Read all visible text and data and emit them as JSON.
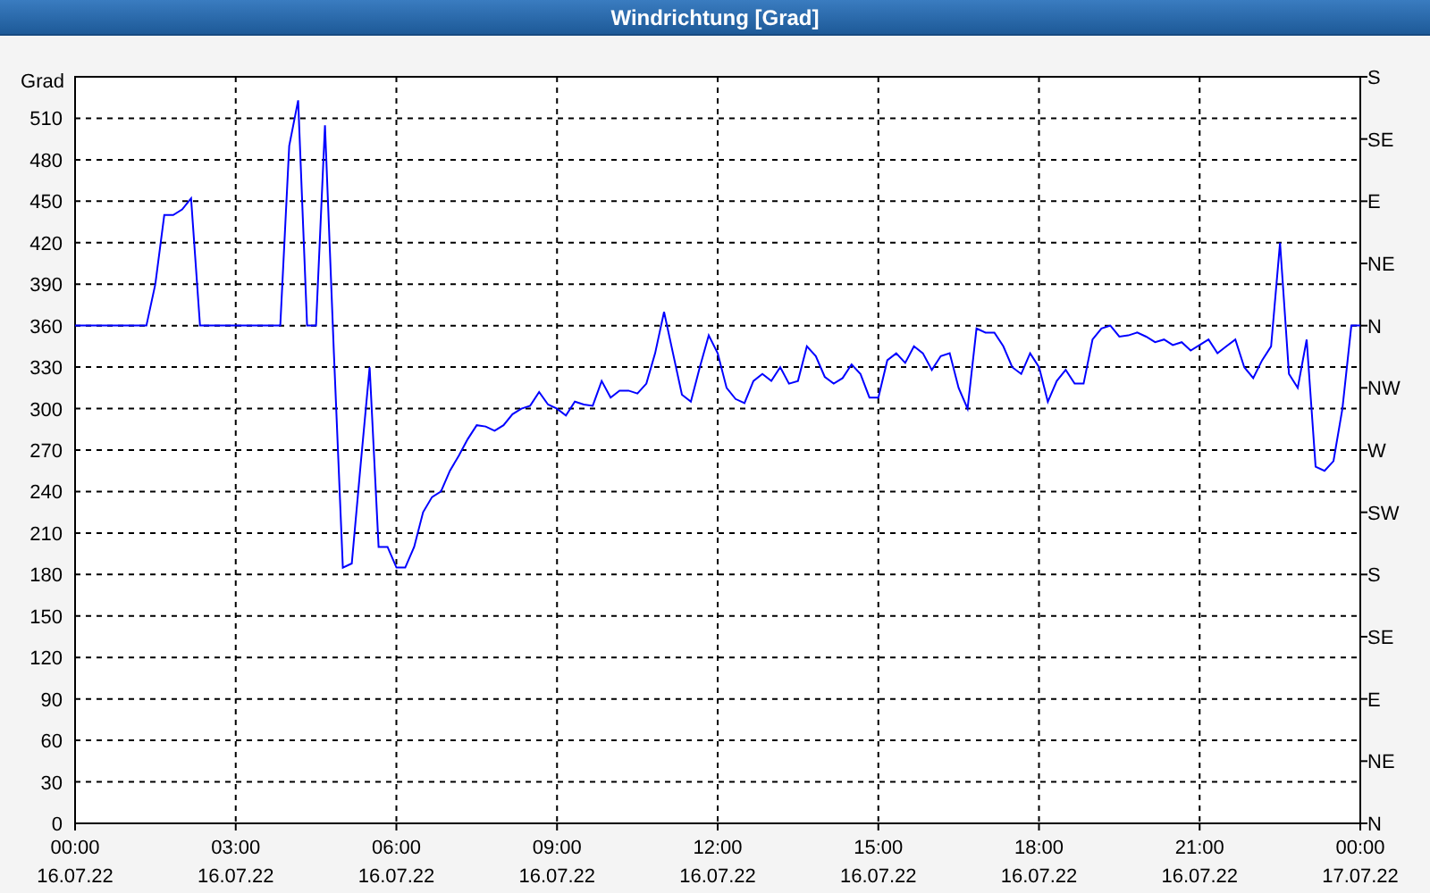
{
  "window": {
    "title": "Windrichtung [Grad]"
  },
  "chart": {
    "right_axis_labels": [
      "S",
      "SE",
      "E",
      "NE",
      "N",
      "NW",
      "W",
      "SW",
      "S",
      "SE",
      "E",
      "NE",
      "N"
    ],
    "chart_data": {
      "type": "line",
      "ylabel": "Grad",
      "grid": true,
      "ylim": [
        0,
        540
      ],
      "yticks": [
        0,
        30,
        60,
        90,
        120,
        150,
        180,
        210,
        240,
        270,
        300,
        330,
        360,
        390,
        420,
        450,
        480,
        510
      ],
      "categories": [
        "00:00\n16.07.22",
        null,
        null,
        null,
        null,
        null,
        null,
        null,
        null,
        null,
        null,
        null,
        null,
        null,
        null,
        null,
        null,
        null,
        "03:00\n16.07.22",
        null,
        null,
        null,
        null,
        null,
        null,
        null,
        null,
        null,
        null,
        null,
        null,
        null,
        null,
        null,
        null,
        null,
        "06:00\n16.07.22",
        null,
        null,
        null,
        null,
        null,
        null,
        null,
        null,
        null,
        null,
        null,
        null,
        null,
        null,
        null,
        null,
        null,
        "09:00\n16.07.22",
        null,
        null,
        null,
        null,
        null,
        null,
        null,
        null,
        null,
        null,
        null,
        null,
        null,
        null,
        null,
        null,
        null,
        "12:00\n16.07.22",
        null,
        null,
        null,
        null,
        null,
        null,
        null,
        null,
        null,
        null,
        null,
        null,
        null,
        null,
        null,
        null,
        null,
        "15:00\n16.07.22",
        null,
        null,
        null,
        null,
        null,
        null,
        null,
        null,
        null,
        null,
        null,
        null,
        null,
        null,
        null,
        null,
        null,
        "18:00\n16.07.22",
        null,
        null,
        null,
        null,
        null,
        null,
        null,
        null,
        null,
        null,
        null,
        null,
        null,
        null,
        null,
        null,
        null,
        "21:00\n16.07.22",
        null,
        null,
        null,
        null,
        null,
        null,
        null,
        null,
        null,
        null,
        null,
        null,
        null,
        null,
        null,
        null,
        null,
        "00:00\n17.07.22"
      ],
      "series": [
        {
          "color": "#0000ff",
          "values": [
            360,
            360,
            360,
            360,
            360,
            360,
            360,
            360,
            360,
            390,
            440,
            440,
            444,
            452,
            360,
            360,
            360,
            360,
            360,
            360,
            360,
            360,
            360,
            360,
            490,
            523,
            360,
            360,
            505,
            340,
            185,
            188,
            260,
            330,
            200,
            200,
            185,
            185,
            200,
            225,
            236,
            240,
            255,
            266,
            278,
            288,
            287,
            284,
            288,
            296,
            300,
            302,
            312,
            303,
            300,
            295,
            305,
            303,
            302,
            320,
            308,
            313,
            313,
            311,
            318,
            340,
            370,
            340,
            310,
            305,
            330,
            353,
            340,
            315,
            307,
            304,
            320,
            325,
            320,
            330,
            318,
            320,
            345,
            338,
            323,
            318,
            322,
            332,
            325,
            308,
            308,
            335,
            340,
            333,
            345,
            340,
            328,
            338,
            340,
            315,
            300,
            358,
            355,
            355,
            345,
            330,
            325,
            340,
            330,
            305,
            320,
            328,
            318,
            318,
            350,
            358,
            360,
            352,
            353,
            355,
            352,
            348,
            350,
            346,
            348,
            342,
            346,
            350,
            340,
            345,
            350,
            330,
            322,
            335,
            345,
            420,
            325,
            315,
            350,
            258,
            255,
            262,
            300,
            360,
            360
          ]
        }
      ]
    }
  }
}
